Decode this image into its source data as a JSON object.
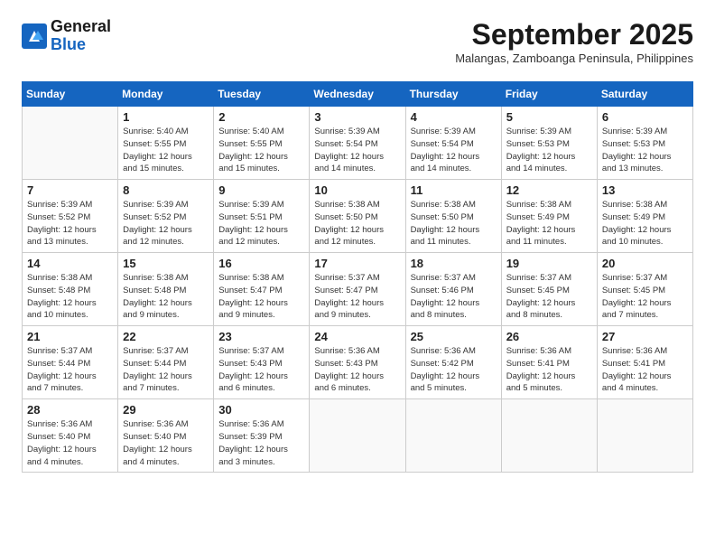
{
  "header": {
    "logo_line1": "General",
    "logo_line2": "Blue",
    "month_title": "September 2025",
    "subtitle": "Malangas, Zamboanga Peninsula, Philippines"
  },
  "days_of_week": [
    "Sunday",
    "Monday",
    "Tuesday",
    "Wednesday",
    "Thursday",
    "Friday",
    "Saturday"
  ],
  "weeks": [
    [
      {
        "day": "",
        "info": ""
      },
      {
        "day": "1",
        "info": "Sunrise: 5:40 AM\nSunset: 5:55 PM\nDaylight: 12 hours\nand 15 minutes."
      },
      {
        "day": "2",
        "info": "Sunrise: 5:40 AM\nSunset: 5:55 PM\nDaylight: 12 hours\nand 15 minutes."
      },
      {
        "day": "3",
        "info": "Sunrise: 5:39 AM\nSunset: 5:54 PM\nDaylight: 12 hours\nand 14 minutes."
      },
      {
        "day": "4",
        "info": "Sunrise: 5:39 AM\nSunset: 5:54 PM\nDaylight: 12 hours\nand 14 minutes."
      },
      {
        "day": "5",
        "info": "Sunrise: 5:39 AM\nSunset: 5:53 PM\nDaylight: 12 hours\nand 14 minutes."
      },
      {
        "day": "6",
        "info": "Sunrise: 5:39 AM\nSunset: 5:53 PM\nDaylight: 12 hours\nand 13 minutes."
      }
    ],
    [
      {
        "day": "7",
        "info": "Sunrise: 5:39 AM\nSunset: 5:52 PM\nDaylight: 12 hours\nand 13 minutes."
      },
      {
        "day": "8",
        "info": "Sunrise: 5:39 AM\nSunset: 5:52 PM\nDaylight: 12 hours\nand 12 minutes."
      },
      {
        "day": "9",
        "info": "Sunrise: 5:39 AM\nSunset: 5:51 PM\nDaylight: 12 hours\nand 12 minutes."
      },
      {
        "day": "10",
        "info": "Sunrise: 5:38 AM\nSunset: 5:50 PM\nDaylight: 12 hours\nand 12 minutes."
      },
      {
        "day": "11",
        "info": "Sunrise: 5:38 AM\nSunset: 5:50 PM\nDaylight: 12 hours\nand 11 minutes."
      },
      {
        "day": "12",
        "info": "Sunrise: 5:38 AM\nSunset: 5:49 PM\nDaylight: 12 hours\nand 11 minutes."
      },
      {
        "day": "13",
        "info": "Sunrise: 5:38 AM\nSunset: 5:49 PM\nDaylight: 12 hours\nand 10 minutes."
      }
    ],
    [
      {
        "day": "14",
        "info": "Sunrise: 5:38 AM\nSunset: 5:48 PM\nDaylight: 12 hours\nand 10 minutes."
      },
      {
        "day": "15",
        "info": "Sunrise: 5:38 AM\nSunset: 5:48 PM\nDaylight: 12 hours\nand 9 minutes."
      },
      {
        "day": "16",
        "info": "Sunrise: 5:38 AM\nSunset: 5:47 PM\nDaylight: 12 hours\nand 9 minutes."
      },
      {
        "day": "17",
        "info": "Sunrise: 5:37 AM\nSunset: 5:47 PM\nDaylight: 12 hours\nand 9 minutes."
      },
      {
        "day": "18",
        "info": "Sunrise: 5:37 AM\nSunset: 5:46 PM\nDaylight: 12 hours\nand 8 minutes."
      },
      {
        "day": "19",
        "info": "Sunrise: 5:37 AM\nSunset: 5:45 PM\nDaylight: 12 hours\nand 8 minutes."
      },
      {
        "day": "20",
        "info": "Sunrise: 5:37 AM\nSunset: 5:45 PM\nDaylight: 12 hours\nand 7 minutes."
      }
    ],
    [
      {
        "day": "21",
        "info": "Sunrise: 5:37 AM\nSunset: 5:44 PM\nDaylight: 12 hours\nand 7 minutes."
      },
      {
        "day": "22",
        "info": "Sunrise: 5:37 AM\nSunset: 5:44 PM\nDaylight: 12 hours\nand 7 minutes."
      },
      {
        "day": "23",
        "info": "Sunrise: 5:37 AM\nSunset: 5:43 PM\nDaylight: 12 hours\nand 6 minutes."
      },
      {
        "day": "24",
        "info": "Sunrise: 5:36 AM\nSunset: 5:43 PM\nDaylight: 12 hours\nand 6 minutes."
      },
      {
        "day": "25",
        "info": "Sunrise: 5:36 AM\nSunset: 5:42 PM\nDaylight: 12 hours\nand 5 minutes."
      },
      {
        "day": "26",
        "info": "Sunrise: 5:36 AM\nSunset: 5:41 PM\nDaylight: 12 hours\nand 5 minutes."
      },
      {
        "day": "27",
        "info": "Sunrise: 5:36 AM\nSunset: 5:41 PM\nDaylight: 12 hours\nand 4 minutes."
      }
    ],
    [
      {
        "day": "28",
        "info": "Sunrise: 5:36 AM\nSunset: 5:40 PM\nDaylight: 12 hours\nand 4 minutes."
      },
      {
        "day": "29",
        "info": "Sunrise: 5:36 AM\nSunset: 5:40 PM\nDaylight: 12 hours\nand 4 minutes."
      },
      {
        "day": "30",
        "info": "Sunrise: 5:36 AM\nSunset: 5:39 PM\nDaylight: 12 hours\nand 3 minutes."
      },
      {
        "day": "",
        "info": ""
      },
      {
        "day": "",
        "info": ""
      },
      {
        "day": "",
        "info": ""
      },
      {
        "day": "",
        "info": ""
      }
    ]
  ]
}
